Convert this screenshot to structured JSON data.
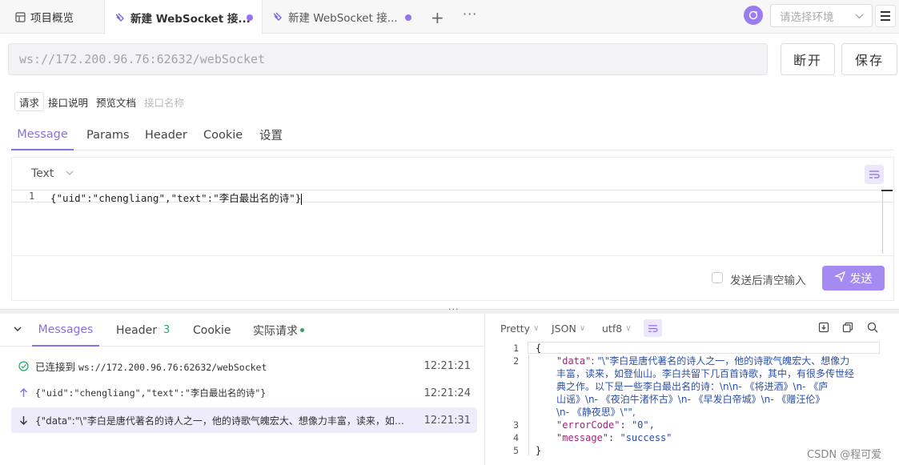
{
  "tabs": {
    "overview": "项目概览",
    "active": "新建 WebSocket 接...",
    "second": "新建 WebSocket 接..."
  },
  "env": {
    "placeholder": "请选择环境"
  },
  "url": {
    "value": "ws://172.200.96.76:62632/webSocket"
  },
  "actions": {
    "disconnect": "断开",
    "save": "保存"
  },
  "subtabs": {
    "request": "请求",
    "api_doc": "接口说明",
    "preview": "预览文档",
    "name_placeholder": "接口名称"
  },
  "request_tabs": [
    "Message",
    "Params",
    "Header",
    "Cookie",
    "设置"
  ],
  "editor": {
    "mode": "Text",
    "line_number": "1",
    "content": "{\"uid\":\"chengliang\",\"text\":\"李白最出名的诗\"}",
    "clear_after_send": "发送后清空输入",
    "send": "发送"
  },
  "response_tabs": {
    "messages": "Messages",
    "header": "Header",
    "header_count": "3",
    "cookie": "Cookie",
    "actual": "实际请求"
  },
  "messages": [
    {
      "kind": "connected",
      "label": "已连接到",
      "text": "ws://172.200.96.76:62632/webSocket",
      "time": "12:21:21"
    },
    {
      "kind": "sent",
      "text": "{\"uid\":\"chengliang\",\"text\":\"李白最出名的诗\"}",
      "time": "12:21:24"
    },
    {
      "kind": "received",
      "text": "{\"data\":\"\\\"李白是唐代著名的诗人之一，他的诗歌气魄宏大、想像力丰富，读来，如登...",
      "time": "12:21:31"
    }
  ],
  "viewer": {
    "format": "Pretty",
    "type": "JSON",
    "encoding": "utf8",
    "lines": [
      "1",
      "2",
      "3",
      "4",
      "5"
    ],
    "open_brace": "{",
    "close_brace": "}",
    "data_key": "\"data\"",
    "data_value_1": "\"\\\"李白是唐代著名的诗人之一，他的诗歌气魄宏大、想像力",
    "data_value_2": "丰富，读来，如登仙山。李白共留下几百首诗歌，其中，有很多传世经",
    "data_value_3": "典之作。以下是一些李白最出名的诗：\\n\\n- 《将进酒》\\n- 《庐",
    "data_value_4": "山谣》\\n- 《夜泊牛渚怀古》\\n- 《早发白帝城》\\n- 《赠汪伦》",
    "data_value_5": "\\n- 《静夜思》\\\"\",",
    "error_key": "\"errorCode\"",
    "error_value": "\"0\",",
    "message_key": "\"message\"",
    "message_value": "\"success\""
  },
  "watermark": "CSDN @程可爱",
  "colors": {
    "accent": "#8a6de9",
    "send_button": "#a58af2",
    "success": "#2fa56b"
  }
}
